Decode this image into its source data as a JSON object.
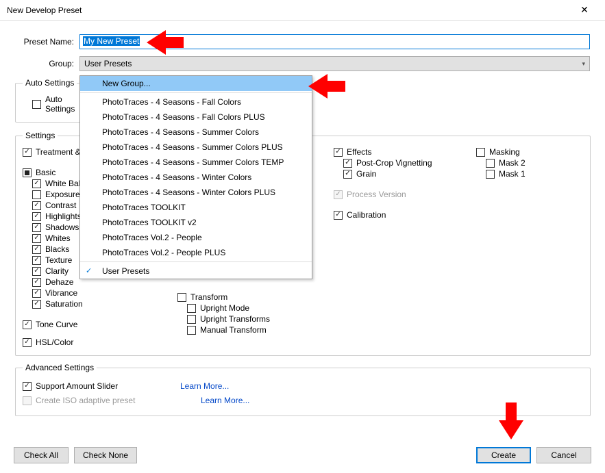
{
  "window": {
    "title": "New Develop Preset",
    "close": "✕"
  },
  "form": {
    "preset_label": "Preset Name:",
    "preset_value": "My New Preset",
    "group_label": "Group:",
    "group_value": "User Presets"
  },
  "dropdown": {
    "new_group": "New Group...",
    "items": [
      "PhotoTraces - 4 Seasons - Fall Colors",
      "PhotoTraces - 4 Seasons - Fall Colors PLUS",
      "PhotoTraces - 4 Seasons - Summer Colors",
      "PhotoTraces - 4 Seasons - Summer Colors PLUS",
      "PhotoTraces - 4 Seasons - Summer Colors TEMP",
      "PhotoTraces - 4 Seasons - Winter Colors",
      "PhotoTraces - 4 Seasons - Winter Colors PLUS",
      "PhotoTraces TOOLKIT",
      "PhotoTraces TOOLKIT v2",
      "PhotoTraces Vol.2 - People",
      "PhotoTraces Vol.2 - People PLUS"
    ],
    "user_presets": "User Presets"
  },
  "auto": {
    "legend": "Auto Settings",
    "auto_settings": "Auto Settings"
  },
  "settings": {
    "legend": "Settings",
    "treatment_profile": "Treatment & Profile",
    "basic": "Basic",
    "white_balance": "White Balance",
    "exposure": "Exposure",
    "contrast": "Contrast",
    "highlights": "Highlights",
    "shadows": "Shadows",
    "whites": "Whites",
    "blacks": "Blacks",
    "texture": "Texture",
    "clarity": "Clarity",
    "dehaze": "Dehaze",
    "vibrance": "Vibrance",
    "saturation": "Saturation",
    "tone_curve": "Tone Curve",
    "hsl_color": "HSL/Color",
    "transform": "Transform",
    "upright_mode": "Upright Mode",
    "upright_transforms": "Upright Transforms",
    "manual_transform": "Manual Transform",
    "effects": "Effects",
    "post_crop_vignetting": "Post-Crop Vignetting",
    "grain": "Grain",
    "process_version": "Process Version",
    "calibration": "Calibration",
    "masking": "Masking",
    "mask2": "Mask 2",
    "mask1": "Mask 1"
  },
  "advanced": {
    "legend": "Advanced Settings",
    "support_amount": "Support Amount Slider",
    "create_iso": "Create ISO adaptive preset",
    "learn_more": "Learn More..."
  },
  "buttons": {
    "check_all": "Check All",
    "check_none": "Check None",
    "create": "Create",
    "cancel": "Cancel"
  }
}
